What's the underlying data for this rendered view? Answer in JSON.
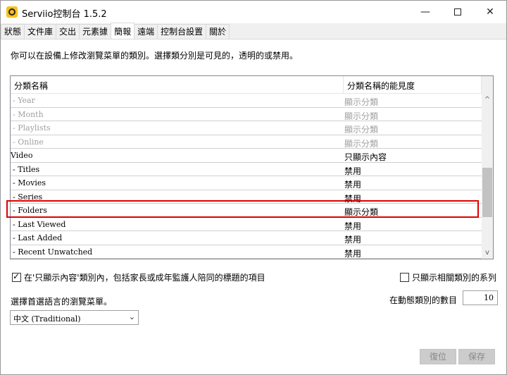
{
  "window": {
    "title": "Serviio控制台 1.5.2",
    "minimize": "—",
    "close": "✕"
  },
  "tabs": [
    {
      "label": "狀態"
    },
    {
      "label": "文件庫"
    },
    {
      "label": "交出"
    },
    {
      "label": "元素據"
    },
    {
      "label": "簡報",
      "active": true
    },
    {
      "label": "遠端"
    },
    {
      "label": "控制台設置"
    },
    {
      "label": "關於"
    }
  ],
  "description": "你可以在設備上修改瀏覽菜單的類別。選擇類分別是可見的，透明的或禁用。",
  "table": {
    "headers": {
      "name": "分類名稱",
      "visibility": "分類名稱的能見度"
    },
    "rows": [
      {
        "name": "- Year",
        "visibility": "顯示分類",
        "dim": true
      },
      {
        "name": "- Month",
        "visibility": "顯示分類",
        "dim": true
      },
      {
        "name": "- Playlists",
        "visibility": "顯示分類",
        "dim": true
      },
      {
        "name": "- Online",
        "visibility": "顯示分類",
        "dim": true
      },
      {
        "name": "Video",
        "visibility": "只顯示內容",
        "dim": false
      },
      {
        "name": "- Titles",
        "visibility": "禁用",
        "dim": false
      },
      {
        "name": "- Movies",
        "visibility": "禁用",
        "dim": false
      },
      {
        "name": "- Series",
        "visibility": "禁用",
        "dim": false
      },
      {
        "name": "- Folders",
        "visibility": "顯示分類",
        "dim": false,
        "highlighted": true
      },
      {
        "name": "- Last Viewed",
        "visibility": "禁用",
        "dim": false
      },
      {
        "name": "- Last Added",
        "visibility": "禁用",
        "dim": false
      },
      {
        "name": "- Recent Unwatched",
        "visibility": "禁用",
        "dim": false
      }
    ],
    "scroll_up": "^",
    "scroll_down": "v"
  },
  "options": {
    "include_parental": {
      "label": "在'只顯示內容'類別內，包括家長或成年監護人陪同的標題的項目",
      "checked": true
    },
    "show_related": {
      "label": "只顯示相關類別的系列",
      "checked": false
    }
  },
  "language": {
    "label": "選擇首選語言的瀏覽菜單。",
    "selected": "中文 (Traditional)",
    "arrow": "⌄"
  },
  "dynamic_count": {
    "label": "在動態類別的數目",
    "value": "10"
  },
  "buttons": {
    "reset": "復位",
    "save": "保存"
  },
  "colors": {
    "highlight_border": "#e00000",
    "dim_text": "#a0a0a0",
    "accent_icon": "#f7c21b"
  }
}
